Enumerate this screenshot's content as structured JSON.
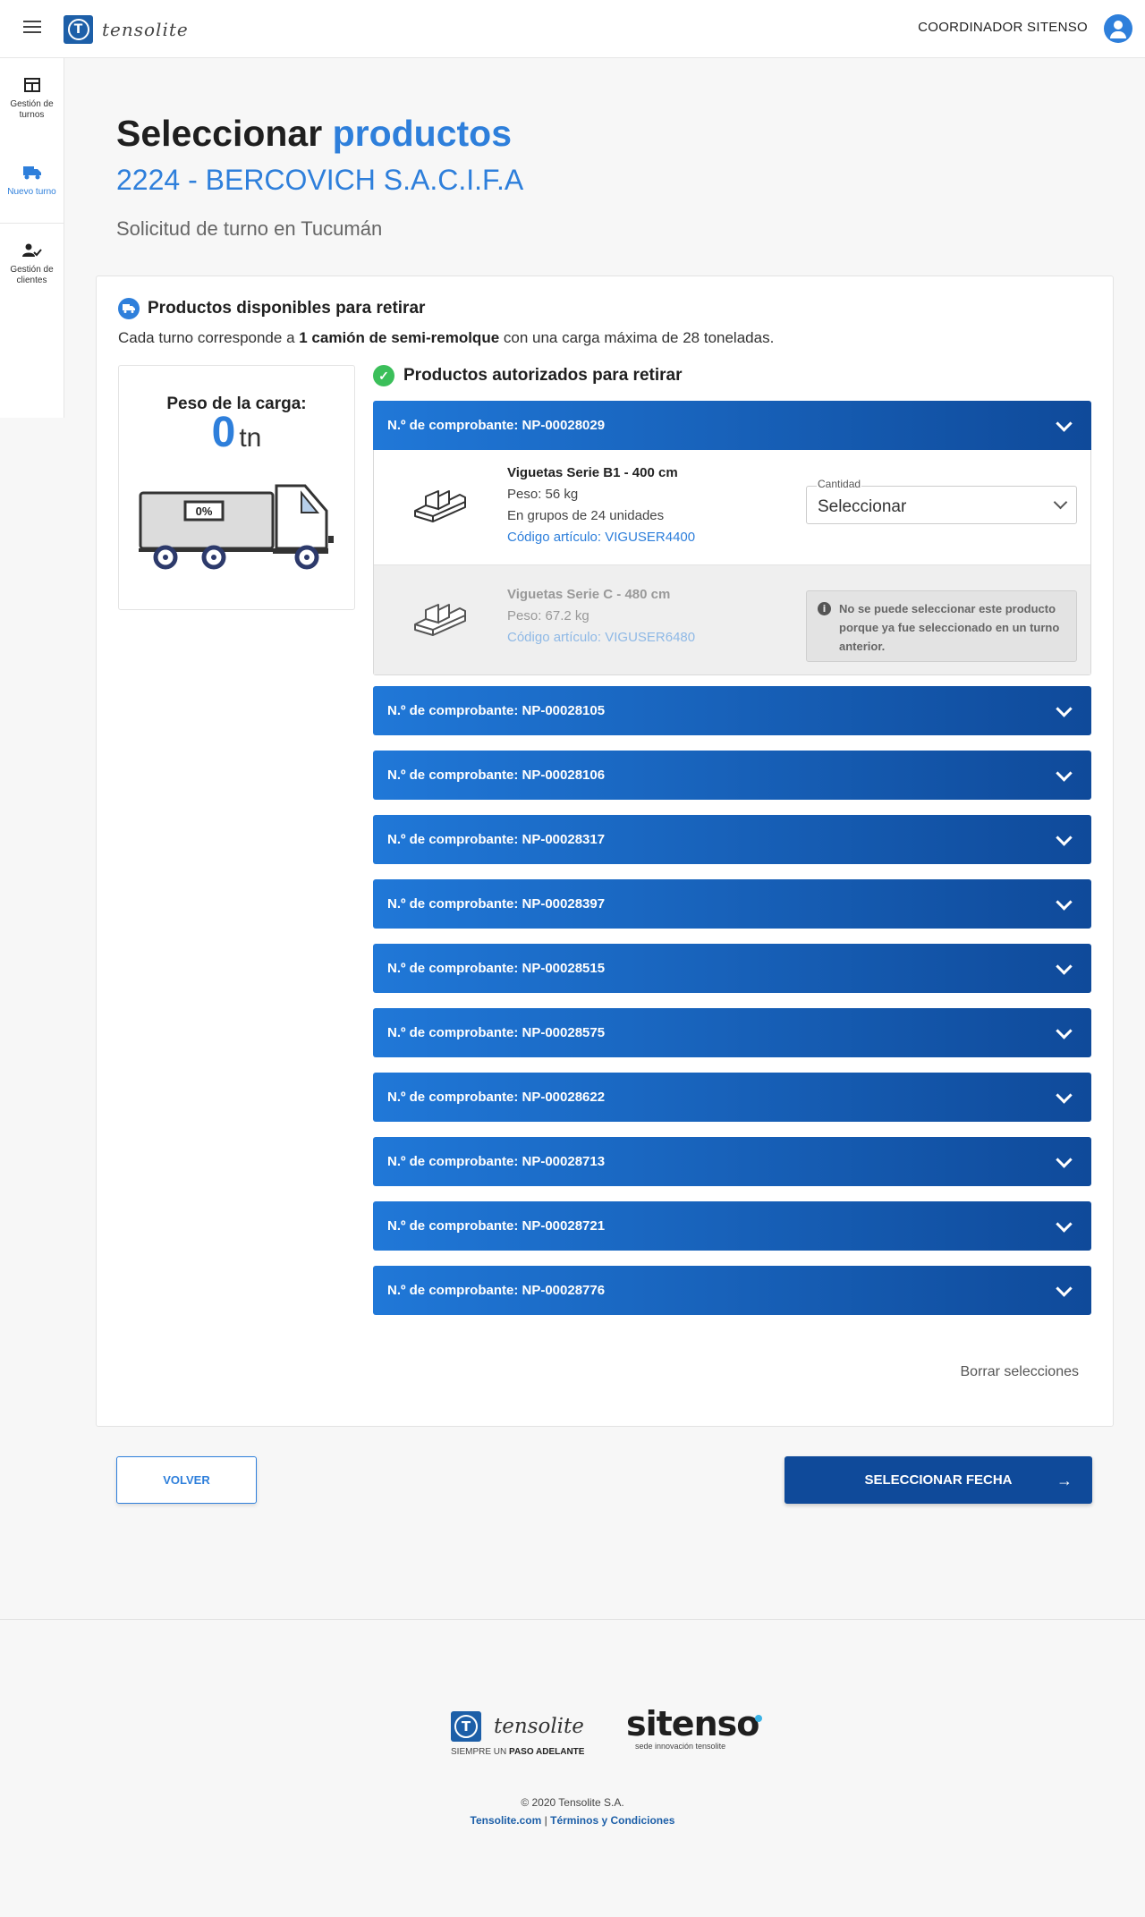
{
  "header": {
    "logo_text": "tensolite",
    "user_name": "COORDINADOR SITENSO"
  },
  "sidebar": {
    "items": [
      {
        "label": "Gestión de turnos",
        "icon": "table-icon",
        "active": false
      },
      {
        "label": "Nuevo turno",
        "icon": "truck-icon",
        "active": true
      },
      {
        "label": "Gestión de clientes",
        "icon": "user-check-icon",
        "active": false
      }
    ]
  },
  "page": {
    "title_plain": "Seleccionar",
    "title_accent": "productos",
    "client": "2224 - BERCOVICH S.A.C.I.F.A",
    "request": "Solicitud de turno en Tucumán"
  },
  "panel": {
    "title": "Productos disponibles para retirar",
    "desc_before": "Cada turno corresponde a ",
    "desc_bold": "1 camión de semi-remolque",
    "desc_after": " con una carga máxima de 28 toneladas.",
    "weight_label": "Peso de la carga:",
    "weight_value": "0",
    "weight_unit": "tn",
    "truck_percent": "0%",
    "load_fraction": 0,
    "authorized_title": "Productos autorizados para retirar",
    "clear_label": "Borrar selecciones"
  },
  "receipts": [
    {
      "label": "N.º de comprobante: NP-00028029",
      "open": true
    },
    {
      "label": "N.º de comprobante: NP-00028105",
      "open": false
    },
    {
      "label": "N.º de comprobante: NP-00028106",
      "open": false
    },
    {
      "label": "N.º de comprobante: NP-00028317",
      "open": false
    },
    {
      "label": "N.º de comprobante: NP-00028397",
      "open": false
    },
    {
      "label": "N.º de comprobante: NP-00028515",
      "open": false
    },
    {
      "label": "N.º de comprobante: NP-00028575",
      "open": false
    },
    {
      "label": "N.º de comprobante: NP-00028622",
      "open": false
    },
    {
      "label": "N.º de comprobante: NP-00028713",
      "open": false
    },
    {
      "label": "N.º de comprobante: NP-00028721",
      "open": false
    },
    {
      "label": "N.º de comprobante: NP-00028776",
      "open": false
    }
  ],
  "products": [
    {
      "name": "Viguetas Serie B1 - 400 cm",
      "weight": "Peso: 56 kg",
      "group": "En grupos de 24 unidades",
      "code": "Código artículo: VIGUSER4400",
      "qty_label": "Cantidad",
      "qty_value": "Seleccionar"
    },
    {
      "name": "Viguetas Serie C - 480 cm",
      "weight": "Peso: 67.2 kg",
      "code": "Código artículo: VIGUSER6480",
      "warning": "No se puede seleccionar este producto porque ya fue seleccionado en un turno anterior."
    }
  ],
  "actions": {
    "back_label": "VOLVER",
    "next_label": "SELECCIONAR FECHA"
  },
  "footer": {
    "tensolite_word": "tensolite",
    "tagline_plain": "SIEMPRE UN ",
    "tagline_bold": "PASO ADELANTE",
    "sitenso_word": "sitenso",
    "sitenso_tag": "sede innovación tensolite",
    "copyright": "© 2020 Tensolite S.A.",
    "link1": "Tensolite.com",
    "separator": " | ",
    "link2": "Términos y Condiciones"
  }
}
